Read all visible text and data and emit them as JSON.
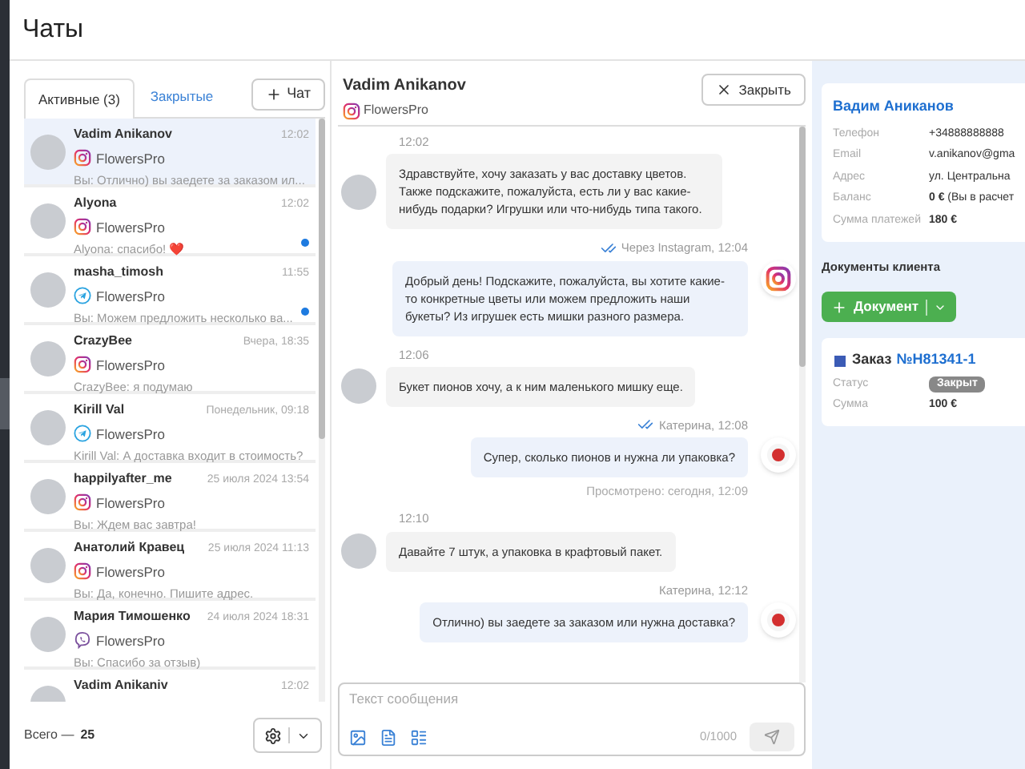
{
  "title": "Чаты",
  "tabs": [
    {
      "label": "Активные (3)",
      "selected": true
    },
    {
      "label": "Закрытые",
      "selected": false
    }
  ],
  "new_chat_button": "Чат",
  "chats": [
    {
      "name": "Vadim Anikanov",
      "time": "12:02",
      "channel": {
        "kind": "instagram"
      },
      "account": "FlowersPro",
      "preview": "Вы: Отлично) вы заедете за заказом ил...",
      "unread": false,
      "selected": true
    },
    {
      "name": "Alyona",
      "time": "12:02",
      "channel": {
        "kind": "instagram"
      },
      "account": "FlowersPro",
      "preview": "Alyona: спасибо! ❤️",
      "unread": true,
      "selected": false
    },
    {
      "name": "masha_timosh",
      "time": "11:55",
      "channel": {
        "kind": "telegram"
      },
      "account": "FlowersPro",
      "preview": "Вы: Можем предложить несколько ва...",
      "unread": true,
      "selected": false
    },
    {
      "name": "CrazyBee",
      "time": "Вчера, 18:35",
      "channel": {
        "kind": "instagram"
      },
      "account": "FlowersPro",
      "preview": "CrazyBee: я подумаю",
      "unread": false,
      "selected": false
    },
    {
      "name": "Kirill Val",
      "time": "Понедельник, 09:18",
      "channel": {
        "kind": "telegram"
      },
      "account": "FlowersPro",
      "preview": "Kirill Val: А доставка входит в стоимость?",
      "unread": false,
      "selected": false
    },
    {
      "name": "happilyafter_me",
      "time": "25 июля 2024 13:54",
      "channel": {
        "kind": "instagram"
      },
      "account": "FlowersPro",
      "preview": "Вы: Ждем вас завтра!",
      "unread": false,
      "selected": false
    },
    {
      "name": "Анатолий Кравец",
      "time": "25 июля 2024 11:13",
      "channel": {
        "kind": "instagram"
      },
      "account": "FlowersPro",
      "preview": "Вы: Да, конечно. Пишите адрес.",
      "unread": false,
      "selected": false
    },
    {
      "name": "Мария Тимошенко",
      "time": "24 июля 2024 18:31",
      "channel": {
        "kind": "viber"
      },
      "account": "FlowersPro",
      "preview": "Вы: Спасибо за отзыв)",
      "unread": false,
      "selected": false
    },
    {
      "name": "Vadim Anikaniv",
      "time": "12:02",
      "unread": false,
      "selected": false
    }
  ],
  "total_label": "Всего —",
  "total_value": "25",
  "conversation": {
    "name": "Vadim Anikanov",
    "channel": {
      "kind": "instagram"
    },
    "account": "FlowersPro",
    "close_button": "Закрыть"
  },
  "messages": [
    {
      "kind": "incoming",
      "meta": "12:02",
      "text": "Здравствуйте, хочу заказать у вас доставку цветов. Также подскажите, пожалуйста, есть ли у вас какие-нибудь подарки? Игрушки или что-нибудь типа такого."
    },
    {
      "kind": "outgoing",
      "sender": {
        "kind": "instagram"
      },
      "delivered": true,
      "meta": "Через Instagram, 12:04",
      "text": "Добрый день! Подскажите, пожалуйста, вы хотите какие-то конкретные цветы или можем предложить наши букеты? Из игрушек есть мишки разного размера."
    },
    {
      "kind": "incoming",
      "meta": "12:06",
      "text": "Букет пионов хочу, а к ним маленького мишку еще."
    },
    {
      "kind": "outgoing",
      "sender": {
        "kind": "agent"
      },
      "delivered": true,
      "meta": "Катерина, 12:08",
      "text": "Супер, сколько пионов и нужна ли упаковка?",
      "seen": "Просмотрено: сегодня, 12:09"
    },
    {
      "kind": "incoming",
      "meta": "12:10",
      "text": "Давайте 7 штук, а упаковка в крафтовый пакет."
    },
    {
      "kind": "outgoing",
      "sender": {
        "kind": "agent"
      },
      "delivered": false,
      "meta": "Катерина, 12:12",
      "text": "Отлично) вы заедете за заказом или нужна доставка?"
    }
  ],
  "composer": {
    "placeholder": "Текст сообщения",
    "counter": "0/1000"
  },
  "client": {
    "name": "Вадим Аниканов",
    "fields": [
      {
        "label": "Телефон",
        "value": "+34888888888"
      },
      {
        "label": "Email",
        "value": "v.anikanov@gma"
      },
      {
        "label": "Адрес",
        "value": "ул. Центральна"
      },
      {
        "label": "Баланс",
        "value": "**0 €** (Вы в расчет"
      },
      {
        "label": "Сумма платежей",
        "value": "**180 €**"
      }
    ]
  },
  "documents_title": "Документы клиента",
  "document_button": "Документ",
  "order": {
    "title": "Заказ",
    "number": "№H81341-1",
    "fields": [
      {
        "label": "Статус",
        "value": "Закрыт",
        "kind": "badge"
      },
      {
        "label": "Сумма",
        "value": "100 €",
        "kind": "text"
      }
    ]
  }
}
